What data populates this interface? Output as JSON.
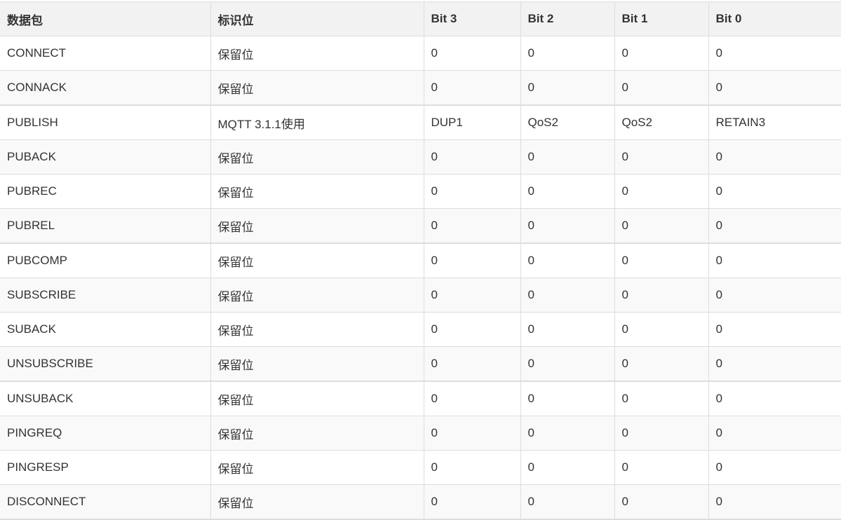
{
  "table": {
    "headers": [
      "数据包",
      "标识位",
      "Bit 3",
      "Bit 2",
      "Bit 1",
      "Bit 0"
    ],
    "rows": [
      [
        "CONNECT",
        "保留位",
        "0",
        "0",
        "0",
        "0"
      ],
      [
        "CONNACK",
        "保留位",
        "0",
        "0",
        "0",
        "0"
      ],
      [
        "PUBLISH",
        "MQTT 3.1.1使用",
        "DUP1",
        "QoS2",
        "QoS2",
        "RETAIN3"
      ],
      [
        "PUBACK",
        "保留位",
        "0",
        "0",
        "0",
        "0"
      ],
      [
        "PUBREC",
        "保留位",
        "0",
        "0",
        "0",
        "0"
      ],
      [
        "PUBREL",
        "保留位",
        "0",
        "0",
        "0",
        "0"
      ],
      [
        "PUBCOMP",
        "保留位",
        "0",
        "0",
        "0",
        "0"
      ],
      [
        "SUBSCRIBE",
        "保留位",
        "0",
        "0",
        "0",
        "0"
      ],
      [
        "SUBACK",
        "保留位",
        "0",
        "0",
        "0",
        "0"
      ],
      [
        "UNSUBSCRIBE",
        "保留位",
        "0",
        "0",
        "0",
        "0"
      ],
      [
        "UNSUBACK",
        "保留位",
        "0",
        "0",
        "0",
        "0"
      ],
      [
        "PINGREQ",
        "保留位",
        "0",
        "0",
        "0",
        "0"
      ],
      [
        "PINGRESP",
        "保留位",
        "0",
        "0",
        "0",
        "0"
      ],
      [
        "DISCONNECT",
        "保留位",
        "0",
        "0",
        "0",
        "0"
      ]
    ]
  }
}
